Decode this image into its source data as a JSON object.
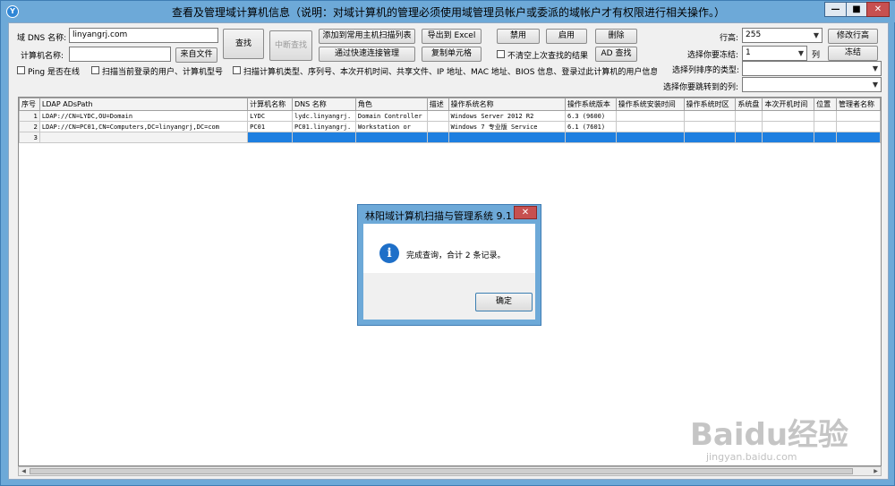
{
  "window": {
    "title": "查看及管理域计算机信息（说明：对域计算机的管理必须使用域管理员帐户或委派的域帐户才有权限进行相关操作。）",
    "app_icon": "Y",
    "minimize": "—",
    "maximize": "■",
    "close": "✕"
  },
  "toolbar": {
    "domain_dns_label": "域 DNS 名称:",
    "domain_dns_value": "linyangrj.com",
    "computer_name_label": "计算机名称:",
    "computer_name_value": "",
    "from_file_btn": "来自文件",
    "search_btn": "查找",
    "interrupt_btn": "中断查找",
    "add_to_list_btn": "添加到常用主机扫描列表",
    "quick_connect_btn": "通过快速连接管理",
    "export_excel_btn": "导出到 Excel",
    "copy_cell_btn": "复制单元格",
    "disable_btn": "禁用",
    "enable_btn": "启用",
    "delete_btn": "删除",
    "ad_search_btn": "AD 查找",
    "keep_results_label": "不清空上次查找的结果",
    "ping_label": "Ping 是否在线",
    "scan_user_label": "扫描当前登录的用户、计算机型号",
    "scan_detail_label": "扫描计算机类型、序列号、本次开机时间、共享文件、IP 地址、MAC 地址、BIOS 信息、登录过此计算机的用户信息等...",
    "row_height_label": "行高:",
    "row_height_value": "255",
    "modify_row_height_btn": "修改行高",
    "freeze_label": "选择你要冻结:",
    "freeze_value": "1",
    "freeze_unit": "列",
    "freeze_btn": "冻结",
    "sort_col_label": "选择列排序的类型:",
    "sort_col_value": "",
    "jump_col_label": "选择你要跳转到的列:",
    "jump_col_value": ""
  },
  "table": {
    "headers": [
      "序号",
      "LDAP ADsPath",
      "计算机名称",
      "DNS 名称",
      "角色",
      "描述",
      "操作系统名称",
      "操作系统版本",
      "操作系统安装时间",
      "操作系统时区",
      "系统盘",
      "本次开机时间",
      "位置",
      "管理者名称"
    ],
    "rows": [
      [
        "1",
        "LDAP://CN=LYDC,OU=Domain",
        "LYDC",
        "lydc.linyangrj.",
        "Domain Controller",
        "",
        "Windows Server 2012 R2",
        "6.3 (9600)",
        "",
        "",
        "",
        "",
        "",
        ""
      ],
      [
        "2",
        "LDAP://CN=PC01,CN=Computers,DC=linyangrj,DC=com",
        "PC01",
        "PC01.linyangrj.",
        "Workstation or",
        "",
        "Windows 7 专业版 Service",
        "6.1 (7601)",
        "",
        "",
        "",
        "",
        "",
        ""
      ],
      [
        "3",
        "",
        "",
        "",
        "",
        "",
        "",
        "",
        "",
        "",
        "",
        "",
        "",
        ""
      ]
    ]
  },
  "dialog": {
    "title": "林阳域计算机扫描与管理系统 9.1",
    "message": "完成查询，合计 2 条记录。",
    "ok_btn": "确定",
    "close": "✕",
    "icon": "i"
  },
  "watermark": {
    "brand": "Baidu经验",
    "url": "jingyan.baidu.com"
  }
}
